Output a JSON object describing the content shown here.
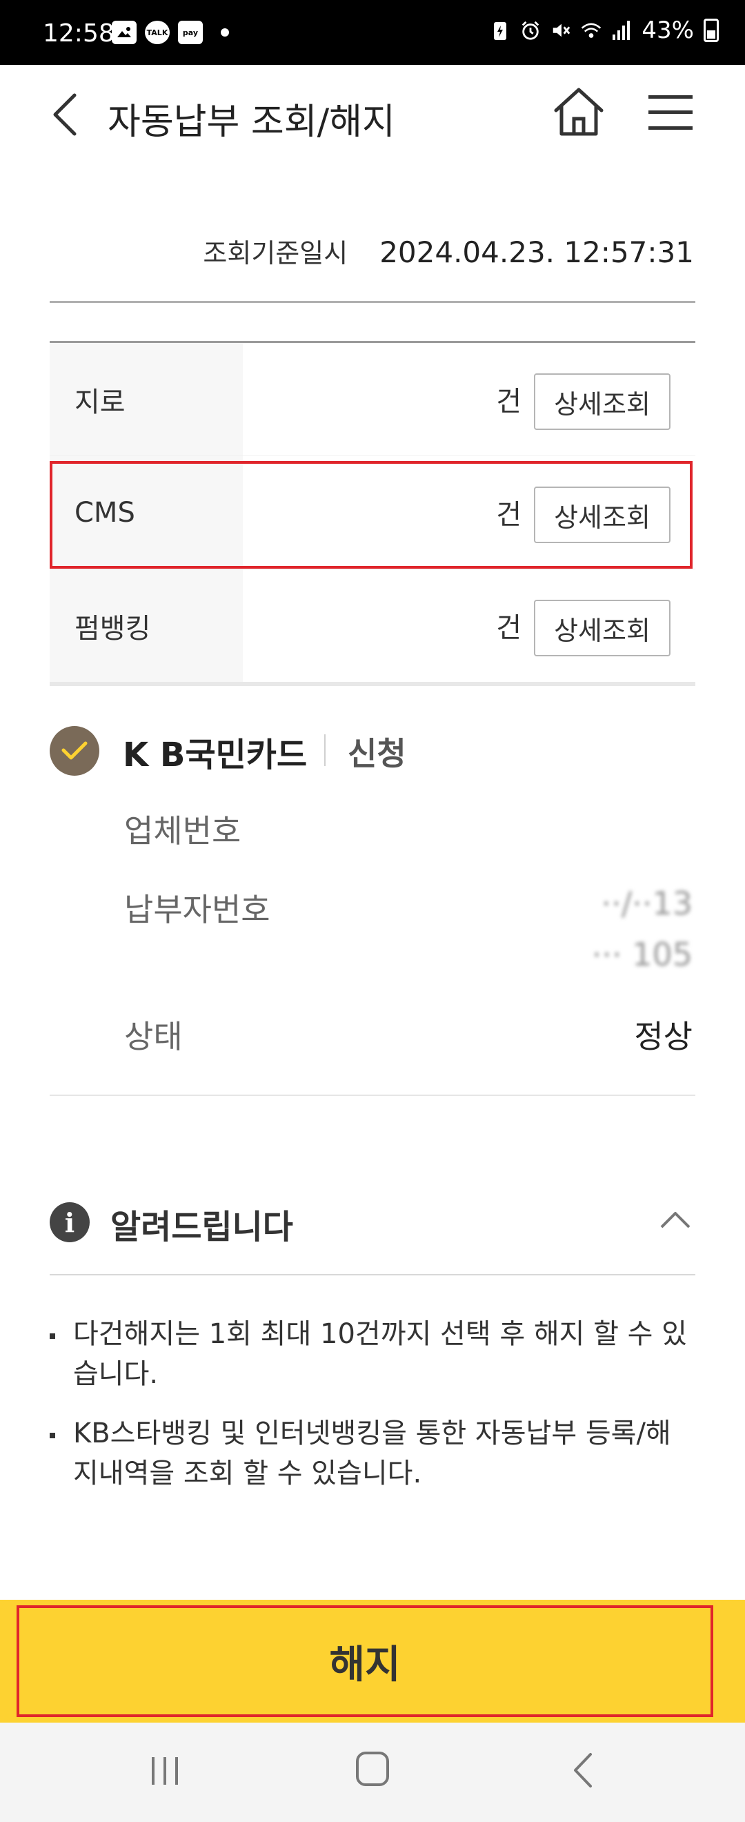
{
  "status_bar": {
    "time": "12:58",
    "battery": "43%",
    "left_icons": [
      "gallery-icon",
      "talk-icon",
      "pay-icon"
    ],
    "talk_label": "TALK",
    "pay_label": "pay"
  },
  "header": {
    "title": "자동납부 조회/해지"
  },
  "inquiry": {
    "label": "조회기준일시",
    "value": "2024.04.23. 12:57:31"
  },
  "table": {
    "rows": [
      {
        "label": "지로",
        "unit": "건",
        "button": "상세조회"
      },
      {
        "label": "CMS",
        "unit": "건",
        "button": "상세조회"
      },
      {
        "label": "펌뱅킹",
        "unit": "건",
        "button": "상세조회"
      }
    ]
  },
  "card": {
    "title": "K B국민카드",
    "status": "신청",
    "fields": [
      {
        "label": "업체번호",
        "value": ""
      },
      {
        "label": "납부자번호",
        "value_line1": "··/··13",
        "value_line2": "··· 105"
      },
      {
        "label": "상태",
        "value": "정상"
      }
    ]
  },
  "notice": {
    "title": "알려드립니다",
    "items": [
      "다건해지는 1회 최대 10건까지 선택 후 해지 할 수 있습니다.",
      "KB스타뱅킹 및 인터넷뱅킹을 통한 자동납부 등록/해지내역을 조회 할 수 있습니다."
    ]
  },
  "action": {
    "label": "해지"
  },
  "colors": {
    "accent_yellow": "#fdd231",
    "highlight_red": "#e0252b",
    "check_brown": "#7a6a58"
  }
}
